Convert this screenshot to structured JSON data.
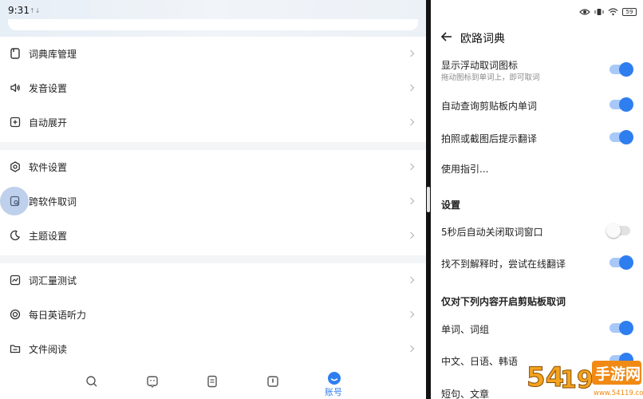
{
  "left_status": {
    "time": "9:31",
    "extra": "↑↓"
  },
  "menu": {
    "group1": [
      {
        "label": "词典库管理",
        "icon": "book-icon"
      },
      {
        "label": "发音设置",
        "icon": "speaker-icon"
      },
      {
        "label": "自动展开",
        "icon": "plus-square-icon"
      }
    ],
    "group2": [
      {
        "label": "软件设置",
        "icon": "hexagon-gear-icon"
      },
      {
        "label": "跨软件取词",
        "icon": "search-window-icon"
      },
      {
        "label": "主题设置",
        "icon": "moon-icon"
      }
    ],
    "group3": [
      {
        "label": "词汇量测试",
        "icon": "chart-square-icon"
      },
      {
        "label": "每日英语听力",
        "icon": "target-icon"
      },
      {
        "label": "文件阅读",
        "icon": "folder-icon"
      }
    ]
  },
  "tabbar": {
    "tabs": [
      {
        "name": "search-tab",
        "icon": "search-icon"
      },
      {
        "name": "chat-tab",
        "icon": "chat-face-icon"
      },
      {
        "name": "notes-tab",
        "icon": "document-icon"
      },
      {
        "name": "book-tab",
        "icon": "open-book-icon"
      }
    ],
    "active_label": "账号"
  },
  "right_status": {
    "battery": "59"
  },
  "right": {
    "title": "欧路词典",
    "items": [
      {
        "label": "显示浮动取词图标",
        "sub": "拖动图标到单词上，即可取词",
        "toggle": true
      },
      {
        "label": "自动查询剪贴板内单词",
        "toggle": true
      },
      {
        "label": "拍照或截图后提示翻译",
        "toggle": true
      },
      {
        "label": "使用指引..."
      }
    ],
    "section1": "设置",
    "items2": [
      {
        "label": "5秒后自动关闭取词窗口",
        "toggle": false
      },
      {
        "label": "找不到解释时，尝试在线翻译",
        "toggle": true
      }
    ],
    "section2": "仅对下列内容开启剪贴板取词",
    "items3": [
      {
        "label": "单词、词组",
        "toggle": true
      },
      {
        "label": "中文、日语、韩语",
        "toggle": true
      },
      {
        "label": "短句、文章"
      }
    ]
  },
  "watermark": {
    "text": "手游网",
    "url": "www.54119.com"
  },
  "colors": {
    "accent": "#2f7ef0",
    "toggle_track_on": "#a8c8f8"
  }
}
